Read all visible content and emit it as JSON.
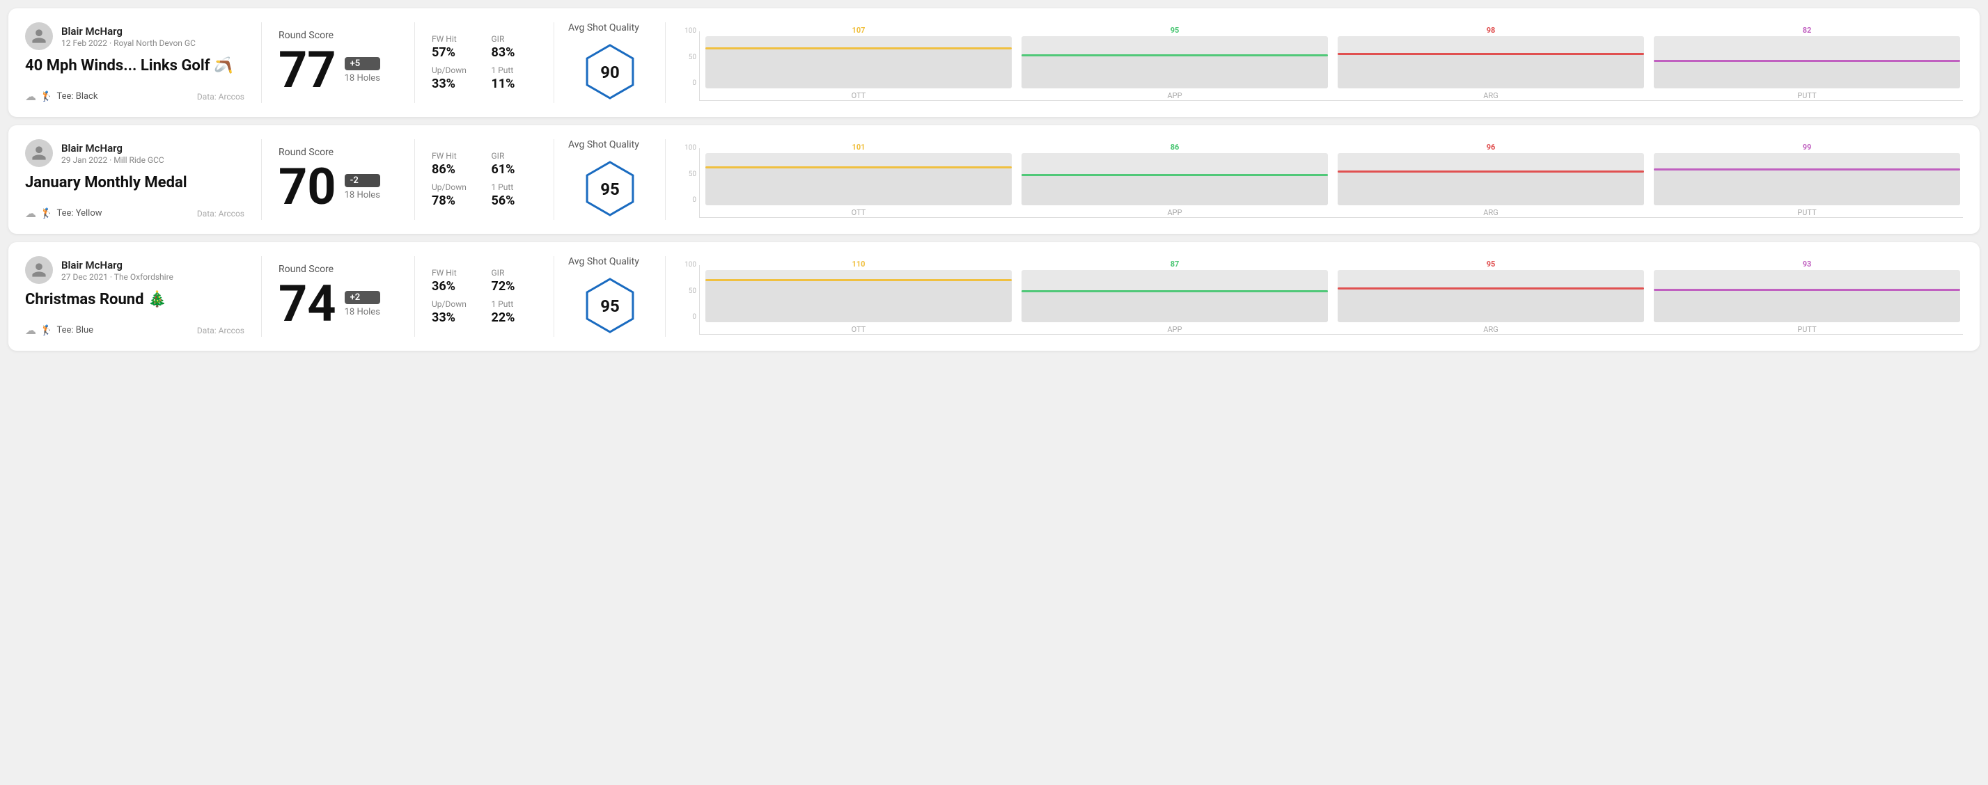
{
  "rounds": [
    {
      "id": "round-1",
      "userName": "Blair McHarg",
      "userDate": "12 Feb 2022 · Royal North Devon GC",
      "roundTitle": "40 Mph Winds... Links Golf 🪃",
      "tee": "Black",
      "dataSource": "Data: Arccos",
      "scoreLabel": "Round Score",
      "scoreNumber": "77",
      "scoreBadge": "+5",
      "scoreHoles": "18 Holes",
      "fwHitLabel": "FW Hit",
      "fwHitValue": "57%",
      "girLabel": "GIR",
      "girValue": "83%",
      "upDownLabel": "Up/Down",
      "upDownValue": "33%",
      "onePuttLabel": "1 Putt",
      "onePuttValue": "11%",
      "qualityLabel": "Avg Shot Quality",
      "qualityScore": "90",
      "chart": {
        "bars": [
          {
            "label": "OTT",
            "topVal": "107",
            "color": "#f0c040",
            "heightPct": 78
          },
          {
            "label": "APP",
            "topVal": "95",
            "color": "#50c878",
            "heightPct": 65
          },
          {
            "label": "ARG",
            "topVal": "98",
            "color": "#e05050",
            "heightPct": 68
          },
          {
            "label": "PUTT",
            "topVal": "82",
            "color": "#c060c0",
            "heightPct": 55
          }
        ],
        "yLabels": [
          "100",
          "50",
          "0"
        ]
      }
    },
    {
      "id": "round-2",
      "userName": "Blair McHarg",
      "userDate": "29 Jan 2022 · Mill Ride GCC",
      "roundTitle": "January Monthly Medal",
      "tee": "Yellow",
      "dataSource": "Data: Arccos",
      "scoreLabel": "Round Score",
      "scoreNumber": "70",
      "scoreBadge": "-2",
      "scoreHoles": "18 Holes",
      "fwHitLabel": "FW Hit",
      "fwHitValue": "86%",
      "girLabel": "GIR",
      "girValue": "61%",
      "upDownLabel": "Up/Down",
      "upDownValue": "78%",
      "onePuttLabel": "1 Putt",
      "onePuttValue": "56%",
      "qualityLabel": "Avg Shot Quality",
      "qualityScore": "95",
      "chart": {
        "bars": [
          {
            "label": "OTT",
            "topVal": "101",
            "color": "#f0c040",
            "heightPct": 74
          },
          {
            "label": "APP",
            "topVal": "86",
            "color": "#50c878",
            "heightPct": 60
          },
          {
            "label": "ARG",
            "topVal": "96",
            "color": "#e05050",
            "heightPct": 67
          },
          {
            "label": "PUTT",
            "topVal": "99",
            "color": "#c060c0",
            "heightPct": 70
          }
        ],
        "yLabels": [
          "100",
          "50",
          "0"
        ]
      }
    },
    {
      "id": "round-3",
      "userName": "Blair McHarg",
      "userDate": "27 Dec 2021 · The Oxfordshire",
      "roundTitle": "Christmas Round 🎄",
      "tee": "Blue",
      "dataSource": "Data: Arccos",
      "scoreLabel": "Round Score",
      "scoreNumber": "74",
      "scoreBadge": "+2",
      "scoreHoles": "18 Holes",
      "fwHitLabel": "FW Hit",
      "fwHitValue": "36%",
      "girLabel": "GIR",
      "girValue": "72%",
      "upDownLabel": "Up/Down",
      "upDownValue": "33%",
      "onePuttLabel": "1 Putt",
      "onePuttValue": "22%",
      "qualityLabel": "Avg Shot Quality",
      "qualityScore": "95",
      "chart": {
        "bars": [
          {
            "label": "OTT",
            "topVal": "110",
            "color": "#f0c040",
            "heightPct": 82
          },
          {
            "label": "APP",
            "topVal": "87",
            "color": "#50c878",
            "heightPct": 61
          },
          {
            "label": "ARG",
            "topVal": "95",
            "color": "#e05050",
            "heightPct": 66
          },
          {
            "label": "PUTT",
            "topVal": "93",
            "color": "#c060c0",
            "heightPct": 64
          }
        ],
        "yLabels": [
          "100",
          "50",
          "0"
        ]
      }
    }
  ]
}
